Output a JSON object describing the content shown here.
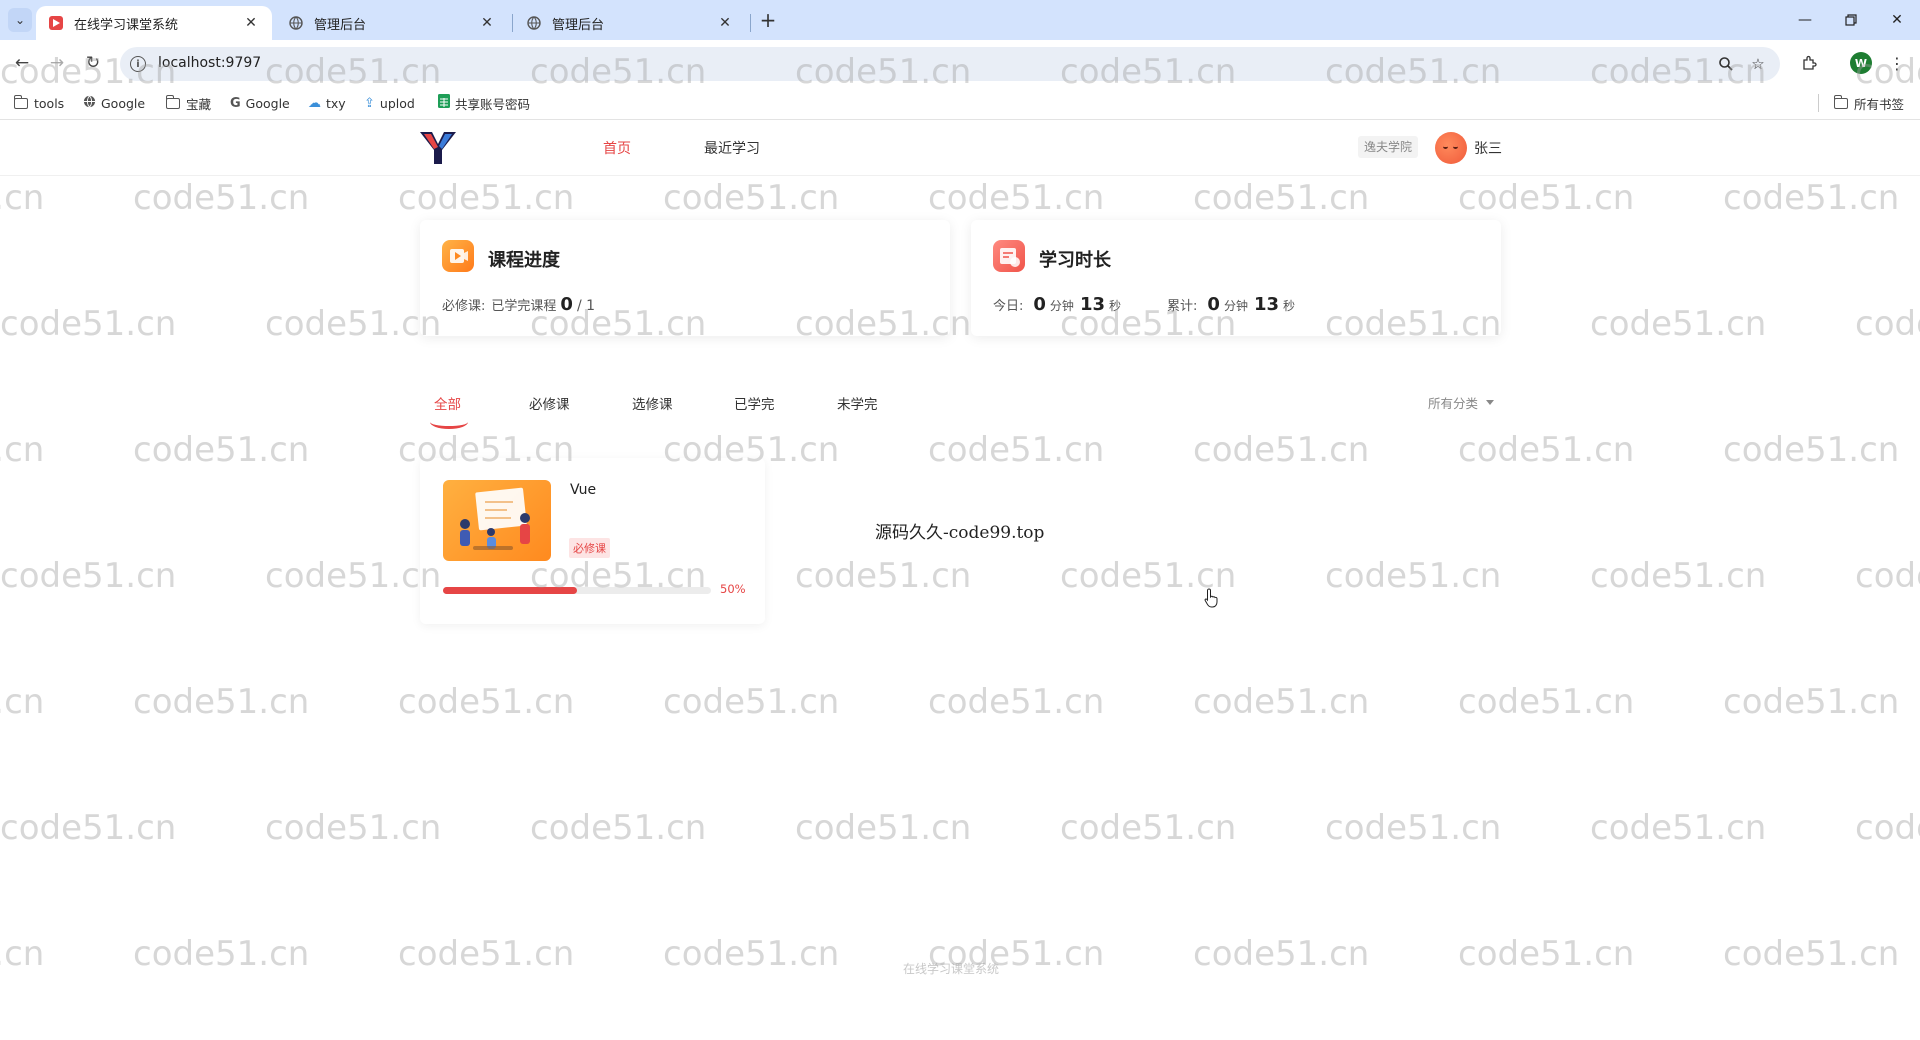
{
  "browser": {
    "tabs": [
      {
        "title": "在线学习课堂系统",
        "active": true
      },
      {
        "title": "管理后台",
        "active": false
      },
      {
        "title": "管理后台",
        "active": false
      }
    ],
    "url": "localhost:9797",
    "profile_initial": "W",
    "bookmarks": [
      {
        "label": "tools",
        "icon": "folder-icon"
      },
      {
        "label": "Google",
        "icon": "globe-icon"
      },
      {
        "label": "宝藏",
        "icon": "folder-icon"
      },
      {
        "label": "Google",
        "icon": "google-icon"
      },
      {
        "label": "txy",
        "icon": "cloud-icon"
      },
      {
        "label": "uplod",
        "icon": "upload-icon"
      },
      {
        "label": "共享账号密码",
        "icon": "sheet-icon"
      }
    ],
    "all_bookmarks_label": "所有书签"
  },
  "header": {
    "nav": [
      {
        "label": "首页",
        "active": true
      },
      {
        "label": "最近学习",
        "active": false
      }
    ],
    "school": "逸夫学院",
    "username": "张三"
  },
  "progress_card": {
    "title": "课程进度",
    "required_label": "必修课:",
    "done_label": "已学完课程",
    "done_count": "0",
    "total": "/ 1"
  },
  "time_card": {
    "title": "学习时长",
    "today_label": "今日:",
    "today_min": "0",
    "today_sec": "13",
    "total_label": "累计:",
    "total_min": "0",
    "total_sec": "13",
    "min_unit": "分钟",
    "sec_unit": "秒"
  },
  "filters": {
    "tabs": [
      {
        "label": "全部",
        "active": true
      },
      {
        "label": "必修课",
        "active": false
      },
      {
        "label": "选修课",
        "active": false
      },
      {
        "label": "已学完",
        "active": false
      },
      {
        "label": "未学完",
        "active": false
      }
    ],
    "category": "所有分类"
  },
  "courses": [
    {
      "name": "Vue",
      "badge": "必修课",
      "progress": 0.5,
      "progress_text": "50%"
    }
  ],
  "center_note": "源码久久-code99.top",
  "footer": "在线学习课堂系统",
  "watermark": "code51.cn",
  "colors": {
    "accent": "#e64545",
    "tabbar": "#d3e3fd"
  }
}
